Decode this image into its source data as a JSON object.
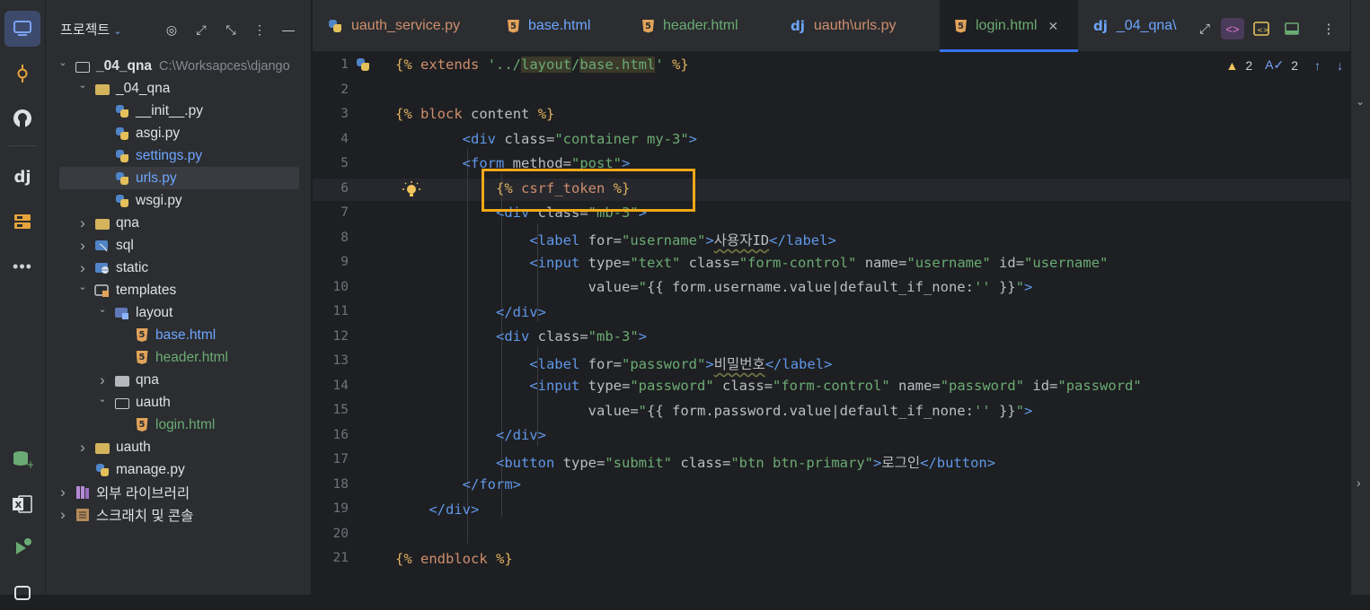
{
  "project_panel": {
    "title": "프로젝트",
    "tree": [
      {
        "label": "_04_qna",
        "path": "C:\\Worksapces\\django",
        "level": 0,
        "expanded": true,
        "icon": "folder-outline"
      },
      {
        "label": "_04_qna",
        "level": 1,
        "expanded": true,
        "icon": "folder"
      },
      {
        "label": "__init__.py",
        "level": 2,
        "icon": "python"
      },
      {
        "label": "asgi.py",
        "level": 2,
        "icon": "python"
      },
      {
        "label": "settings.py",
        "level": 2,
        "icon": "python",
        "color": "blue"
      },
      {
        "label": "urls.py",
        "level": 2,
        "icon": "python",
        "color": "blue",
        "selected": true
      },
      {
        "label": "wsgi.py",
        "level": 2,
        "icon": "python"
      },
      {
        "label": "qna",
        "level": 1,
        "expanded": false,
        "icon": "folder"
      },
      {
        "label": "sql",
        "level": 1,
        "expanded": false,
        "icon": "folder-sql"
      },
      {
        "label": "static",
        "level": 1,
        "expanded": false,
        "icon": "folder-web"
      },
      {
        "label": "templates",
        "level": 1,
        "expanded": true,
        "icon": "folder-templates"
      },
      {
        "label": "layout",
        "level": 2,
        "expanded": true,
        "icon": "folder-layout"
      },
      {
        "label": "base.html",
        "level": 3,
        "icon": "html",
        "color": "blue"
      },
      {
        "label": "header.html",
        "level": 3,
        "icon": "html",
        "color": "green"
      },
      {
        "label": "qna",
        "level": 2,
        "expanded": false,
        "icon": "folder-gray"
      },
      {
        "label": "uauth",
        "level": 2,
        "expanded": true,
        "icon": "folder-outline"
      },
      {
        "label": "login.html",
        "level": 3,
        "icon": "html",
        "color": "green"
      },
      {
        "label": "uauth",
        "level": 1,
        "expanded": false,
        "icon": "folder"
      },
      {
        "label": "manage.py",
        "level": 1,
        "icon": "python"
      },
      {
        "label": "외부 라이브러리",
        "level": 0,
        "expanded": false,
        "icon": "library"
      },
      {
        "label": "스크래치 및 콘솔",
        "level": 0,
        "expanded": false,
        "icon": "scratch"
      }
    ]
  },
  "tabs": [
    {
      "label": "uauth_service.py",
      "icon": "python",
      "color": "#cf8e6d"
    },
    {
      "label": "base.html",
      "icon": "html",
      "color": "#6ea6ff"
    },
    {
      "label": "header.html",
      "icon": "html",
      "color": "#6aab73"
    },
    {
      "label": "uauth\\urls.py",
      "icon": "django",
      "color": "#cf8e6d"
    },
    {
      "label": "login.html",
      "icon": "html",
      "color": "#6aab73",
      "active": true
    },
    {
      "label": "_04_qna\\",
      "icon": "django",
      "color": "#6ea6ff"
    }
  ],
  "inspections": {
    "warnings": "2",
    "typos": "2"
  },
  "editor": {
    "line_numbers": [
      "1",
      "2",
      "3",
      "4",
      "5",
      "6",
      "7",
      "8",
      "9",
      "10",
      "11",
      "12",
      "13",
      "14",
      "15",
      "16",
      "17",
      "18",
      "19",
      "20",
      "21"
    ]
  },
  "colors": {
    "accent": "#3574f0",
    "highlight_box": "#f0a818",
    "template_tag": "#e0b15f",
    "html_tag": "#5f97e8",
    "string": "#6aab73"
  }
}
